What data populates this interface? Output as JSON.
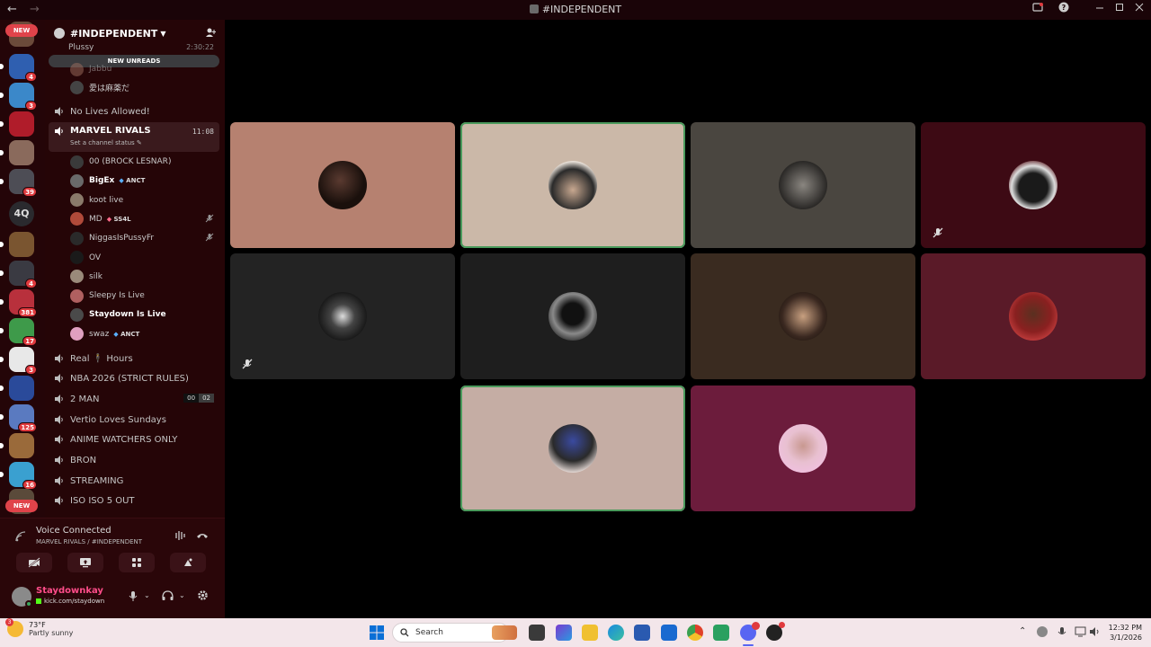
{
  "window": {
    "title": "#INDEPENDENT",
    "back": "←",
    "forward": "→"
  },
  "server_rail": {
    "new_top": "NEW",
    "new_bottom": "NEW",
    "text_server": "4Q",
    "badges": [
      "4",
      "3",
      "39",
      "4",
      "381",
      "17",
      "3",
      "125",
      "16"
    ]
  },
  "guild": {
    "name": "#INDEPENDENT"
  },
  "partial_channel": {
    "name": "Plussy",
    "time": "2:30:22",
    "user1": "Jabbu",
    "user2": "愛は麻薬だ"
  },
  "new_unreads": "NEW UNREADS",
  "channels": {
    "no_lives": "No Lives Allowed!",
    "marvel": {
      "name": "MARVEL RIVALS",
      "time": "11:08",
      "status": "Set a channel status ✎"
    },
    "real_hours": "Real 🕴 Hours",
    "nba": "NBA 2026 (STRICT RULES)",
    "two_man": {
      "name": "2 MAN",
      "count_a": "00",
      "count_b": "02"
    },
    "vertio": "Vertio Loves Sundays",
    "anime": "ANIME WATCHERS ONLY",
    "bron": "BRON",
    "streaming": "STREAMING",
    "iso": "ISO ISO 5 OUT"
  },
  "voice_users": [
    {
      "name": "00 (BROCK LESNAR)",
      "tag": ""
    },
    {
      "name": "BigEx",
      "tag": "ANCT"
    },
    {
      "name": "koot live",
      "tag": ""
    },
    {
      "name": "MD",
      "tag": "SS4L"
    },
    {
      "name": "NiggasIsPussyFr",
      "tag": ""
    },
    {
      "name": "OV",
      "tag": ""
    },
    {
      "name": "silk",
      "tag": ""
    },
    {
      "name": "Sleepy Is Live",
      "tag": ""
    },
    {
      "name": "Staydown Is Live",
      "tag": ""
    },
    {
      "name": "swaz",
      "tag": "ANCT"
    }
  ],
  "voice_panel": {
    "status": "Voice Connected",
    "location": "MARVEL RIVALS / #INDEPENDENT"
  },
  "user_panel": {
    "username": "Staydownkay",
    "subtext": "kick.com/staydown"
  },
  "taskbar": {
    "temperature": "73°F",
    "condition": "Partly sunny",
    "search": "Search",
    "time": "12:32 PM",
    "date": "3/1/2026"
  },
  "colors": {
    "accent_red": "#e0434a",
    "speaking": "#4a9a5c",
    "sidebar_bg": "#250507"
  }
}
